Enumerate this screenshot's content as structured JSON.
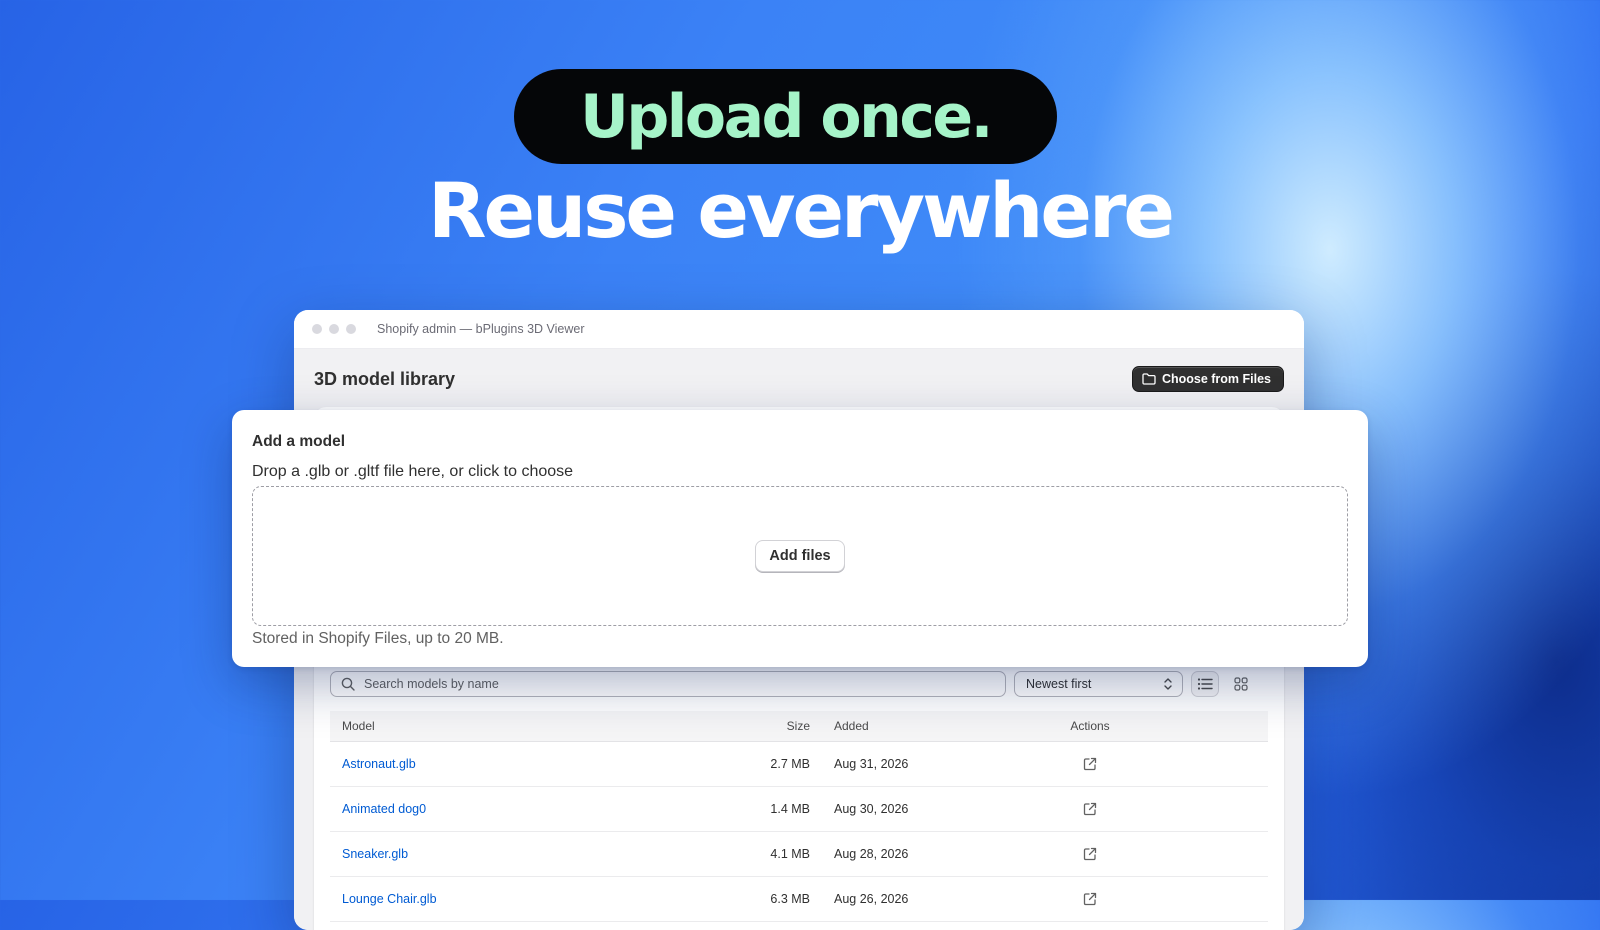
{
  "hero": {
    "line1": "Upload once.",
    "line2": "Reuse everywhere"
  },
  "window": {
    "title": "Shopify admin — bPlugins 3D Viewer"
  },
  "library": {
    "title": "3D model library",
    "choose_button": "Choose from Files",
    "search_placeholder": "Search models by name",
    "sort_selected": "Newest first",
    "columns": {
      "model": "Model",
      "size": "Size",
      "added": "Added",
      "actions": "Actions"
    },
    "rows": [
      {
        "name": "Astronaut.glb",
        "size": "2.7 MB",
        "added": "Aug 31, 2026"
      },
      {
        "name": "Animated dog0",
        "size": "1.4 MB",
        "added": "Aug 30, 2026"
      },
      {
        "name": "Sneaker.glb",
        "size": "4.1 MB",
        "added": "Aug 28, 2026"
      },
      {
        "name": "Lounge Chair.glb",
        "size": "6.3 MB",
        "added": "Aug 26, 2026"
      }
    ]
  },
  "upload": {
    "heading": "Add a model",
    "label": "Drop a .glb or .gltf file here, or click to choose",
    "button": "Add files",
    "help": "Stored in Shopify Files, up to 20 MB."
  },
  "colors": {
    "hero_pill_bg": "#050608",
    "hero_line1": "#a6f4c9",
    "link": "#005bd3",
    "primary_button": "#303030"
  },
  "icons": {
    "choose_button": "folder-icon",
    "search": "search-icon",
    "sort": "sort-chevrons-icon",
    "list_view": "list-view-icon",
    "grid_view": "grid-view-icon",
    "row_action": "external-link-icon"
  }
}
